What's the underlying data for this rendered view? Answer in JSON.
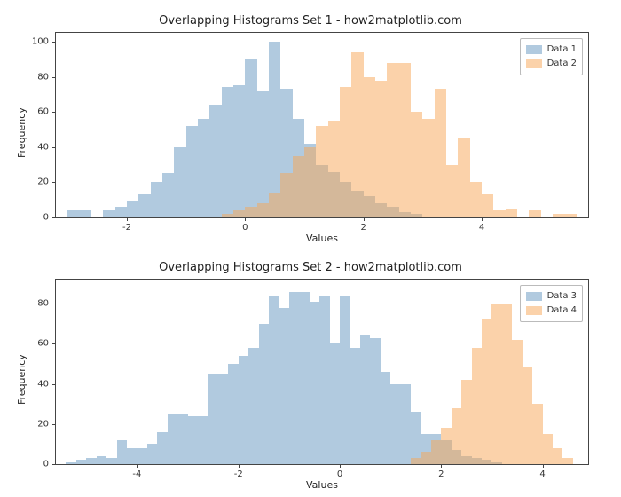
{
  "colors": {
    "blue": "rgba(99,149,192,0.5)",
    "orange": "rgba(247,165,86,0.5)"
  },
  "chart_data": [
    {
      "type": "histogram",
      "title": "Overlapping Histograms Set 1 - how2matplotlib.com",
      "xlabel": "Values",
      "ylabel": "Frequency",
      "xlim": [
        -3.2,
        5.8
      ],
      "ylim": [
        0,
        105
      ],
      "xticks": [
        -2,
        0,
        2,
        4
      ],
      "yticks": [
        0,
        20,
        40,
        60,
        80,
        100
      ],
      "series": [
        {
          "name": "Data 1",
          "color": "blue",
          "bin_edges": [
            -3.0,
            -2.8,
            -2.6,
            -2.4,
            -2.2,
            -2.0,
            -1.8,
            -1.6,
            -1.4,
            -1.2,
            -1.0,
            -0.8,
            -0.6,
            -0.4,
            -0.2,
            0.0,
            0.2,
            0.4,
            0.6,
            0.8,
            1.0,
            1.2,
            1.4,
            1.6,
            1.8,
            2.0,
            2.2,
            2.4,
            2.6,
            2.8,
            3.0
          ],
          "counts": [
            4,
            4,
            0,
            4,
            6,
            9,
            13,
            20,
            25,
            40,
            52,
            56,
            64,
            74,
            75,
            90,
            72,
            100,
            73,
            56,
            42,
            30,
            26,
            20,
            15,
            12,
            8,
            6,
            3,
            2
          ]
        },
        {
          "name": "Data 2",
          "color": "orange",
          "bin_edges": [
            -0.4,
            -0.2,
            0.0,
            0.2,
            0.4,
            0.6,
            0.8,
            1.0,
            1.2,
            1.4,
            1.6,
            1.8,
            2.0,
            2.2,
            2.4,
            2.6,
            2.8,
            3.0,
            3.2,
            3.4,
            3.6,
            3.8,
            4.0,
            4.2,
            4.4,
            4.6,
            4.8,
            5.0,
            5.2,
            5.4,
            5.6
          ],
          "counts": [
            2,
            4,
            6,
            8,
            14,
            25,
            35,
            40,
            52,
            55,
            74,
            94,
            80,
            78,
            88,
            88,
            60,
            56,
            73,
            30,
            45,
            20,
            13,
            4,
            5,
            0,
            4,
            0,
            2,
            2
          ]
        }
      ]
    },
    {
      "type": "histogram",
      "title": "Overlapping Histograms Set 2 - how2matplotlib.com",
      "xlabel": "Values",
      "ylabel": "Frequency",
      "xlim": [
        -5.6,
        4.9
      ],
      "ylim": [
        0,
        92
      ],
      "xticks": [
        -4,
        -2,
        0,
        2,
        4
      ],
      "yticks": [
        0,
        20,
        40,
        60,
        80
      ],
      "series": [
        {
          "name": "Data 3",
          "color": "blue",
          "bin_edges": [
            -5.4,
            -5.2,
            -5.0,
            -4.8,
            -4.6,
            -4.4,
            -4.2,
            -4.0,
            -3.8,
            -3.6,
            -3.4,
            -3.2,
            -3.0,
            -2.8,
            -2.6,
            -2.4,
            -2.2,
            -2.0,
            -1.8,
            -1.6,
            -1.4,
            -1.2,
            -1.0,
            -0.8,
            -0.6,
            -0.4,
            -0.2,
            0.0,
            0.2,
            0.4,
            0.6,
            0.8,
            1.0,
            1.2,
            1.4,
            1.6,
            1.8,
            2.0,
            2.2,
            2.4,
            2.6,
            2.8,
            3.0,
            3.2
          ],
          "counts": [
            1,
            2,
            3,
            4,
            3,
            12,
            8,
            8,
            10,
            16,
            25,
            25,
            24,
            24,
            45,
            45,
            50,
            54,
            58,
            70,
            84,
            78,
            86,
            86,
            81,
            84,
            60,
            84,
            58,
            64,
            63,
            46,
            40,
            40,
            26,
            15,
            15,
            12,
            7,
            4,
            3,
            2,
            1
          ]
        },
        {
          "name": "Data 4",
          "color": "orange",
          "bin_edges": [
            1.4,
            1.6,
            1.8,
            2.0,
            2.2,
            2.4,
            2.6,
            2.8,
            3.0,
            3.2,
            3.4,
            3.6,
            3.8,
            4.0,
            4.2,
            4.4,
            4.6
          ],
          "counts": [
            3,
            6,
            12,
            18,
            28,
            42,
            58,
            72,
            80,
            80,
            62,
            48,
            30,
            15,
            8,
            3
          ]
        }
      ]
    }
  ],
  "charts": [
    {
      "title": "Overlapping Histograms Set 1 - how2matplotlib.com",
      "xlabel": "Values",
      "ylabel": "Frequency",
      "series": [
        {
          "name": "Data 1"
        },
        {
          "name": "Data 2"
        }
      ]
    },
    {
      "title": "Overlapping Histograms Set 2 - how2matplotlib.com",
      "xlabel": "Values",
      "ylabel": "Frequency",
      "series": [
        {
          "name": "Data 3"
        },
        {
          "name": "Data 4"
        }
      ]
    }
  ]
}
